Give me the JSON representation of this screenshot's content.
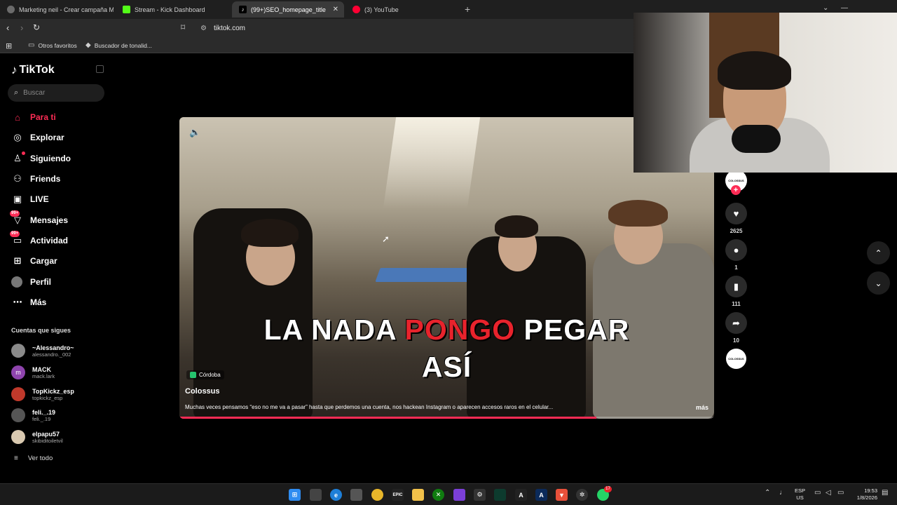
{
  "browser": {
    "tabs": [
      {
        "title": "Marketing neil - Crear campaña Meta",
        "favicon_color": "#6b6b6b"
      },
      {
        "title": "Stream - Kick Dashboard",
        "favicon_color": "#53fc18"
      },
      {
        "title": "(99+)SEO_homepage_title",
        "favicon_color": "#000000"
      },
      {
        "title": "(3) YouTube",
        "favicon_color": "#ff0033"
      }
    ],
    "new_tab": "+",
    "url": "tiktok.com",
    "bookmarks": [
      {
        "label": "Otros favoritos",
        "icon": "folder-icon"
      },
      {
        "label": "Buscador de tonalid...",
        "icon": "bookmark-icon"
      }
    ]
  },
  "tiktok": {
    "logo": "TikTok",
    "search_placeholder": "Buscar",
    "nav": [
      {
        "label": "Para ti",
        "icon": "home-icon",
        "active": true
      },
      {
        "label": "Explorar",
        "icon": "compass-icon"
      },
      {
        "label": "Siguiendo",
        "icon": "following-icon"
      },
      {
        "label": "Friends",
        "icon": "friends-icon"
      },
      {
        "label": "LIVE",
        "icon": "live-icon"
      },
      {
        "label": "Mensajes",
        "icon": "messages-icon",
        "badge": "99+"
      },
      {
        "label": "Actividad",
        "icon": "activity-icon",
        "badge": "99+"
      },
      {
        "label": "Cargar",
        "icon": "upload-icon"
      },
      {
        "label": "Perfil",
        "icon": "profile-icon"
      },
      {
        "label": "Más",
        "icon": "more-icon"
      }
    ],
    "following_title": "Cuentas que sigues",
    "accounts": [
      {
        "name": "~Alessandro~",
        "handle": "alessandro._002",
        "avatar_color": "#8a8a8a"
      },
      {
        "name": "MACK",
        "handle": "mack.lark",
        "avatar_color": "#8e44ad"
      },
      {
        "name": "TopKickz_esp",
        "handle": "topkickz_esp",
        "avatar_color": "#c0392b"
      },
      {
        "name": "feli._.19",
        "handle": "feli._.19",
        "avatar_color": "#555555"
      },
      {
        "name": "elpapu57",
        "handle": "skibiditoiletvil",
        "avatar_color": "#d9c9b0"
      }
    ],
    "see_all": "Ver todo"
  },
  "video": {
    "caption_words": [
      "LA NADA",
      "PONGO",
      "PEGAR"
    ],
    "caption_line2": "ASÍ",
    "location": "Córdoba",
    "author": "Colossus",
    "description": "Muchas veces pensamos “eso no me va a pasar” hasta que perdemos una cuenta, nos hackean Instagram o aparecen accesos raros en el celular...",
    "more": "más",
    "progress": 0.78,
    "accent": "#fe2c55"
  },
  "actions": {
    "avatar_text": "COLOSSUS",
    "likes": "2625",
    "comments": "1",
    "saves": "111",
    "shares": "10",
    "music_text": "COLOSSUS"
  },
  "taskbar": {
    "language": "ESP",
    "region": "US",
    "time": "19:53",
    "date": "1/8/2026",
    "whatsapp_badge": "17"
  }
}
